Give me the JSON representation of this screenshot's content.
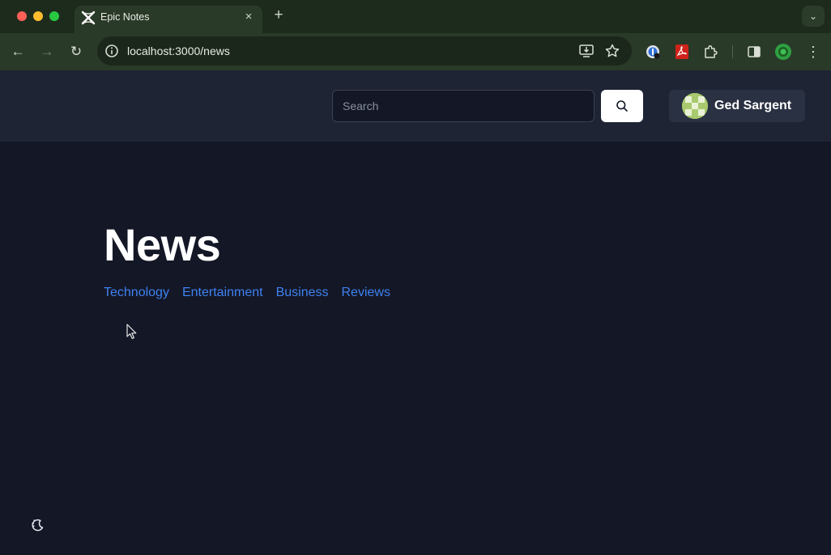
{
  "browser": {
    "tab": {
      "title": "Epic Notes",
      "close_glyph": "×"
    },
    "new_tab_glyph": "+",
    "tab_menu_glyph": "⌄",
    "nav": {
      "back_glyph": "←",
      "forward_glyph": "→",
      "reload_glyph": "↻"
    },
    "omnibox": {
      "url": "localhost:3000/news"
    },
    "icons": [
      "site-info-icon",
      "install-app-icon",
      "bookmark-star-icon",
      "password-manager-icon",
      "pdf-extension-icon",
      "extensions-puzzle-icon",
      "side-panel-icon",
      "profile-icon",
      "more-menu-icon"
    ],
    "more_glyph": "⋮"
  },
  "header": {
    "search": {
      "placeholder": "Search",
      "value": ""
    },
    "user": {
      "name": "Ged Sargent"
    }
  },
  "main": {
    "title": "News",
    "categories": [
      "Technology",
      "Entertainment",
      "Business",
      "Reviews"
    ]
  },
  "colors": {
    "page_bg": "#131726",
    "header_bg": "#1e2433",
    "link": "#3f82f1",
    "chrome_tabbar": "#1d2b1d",
    "chrome_toolbar": "#2a3a28"
  }
}
